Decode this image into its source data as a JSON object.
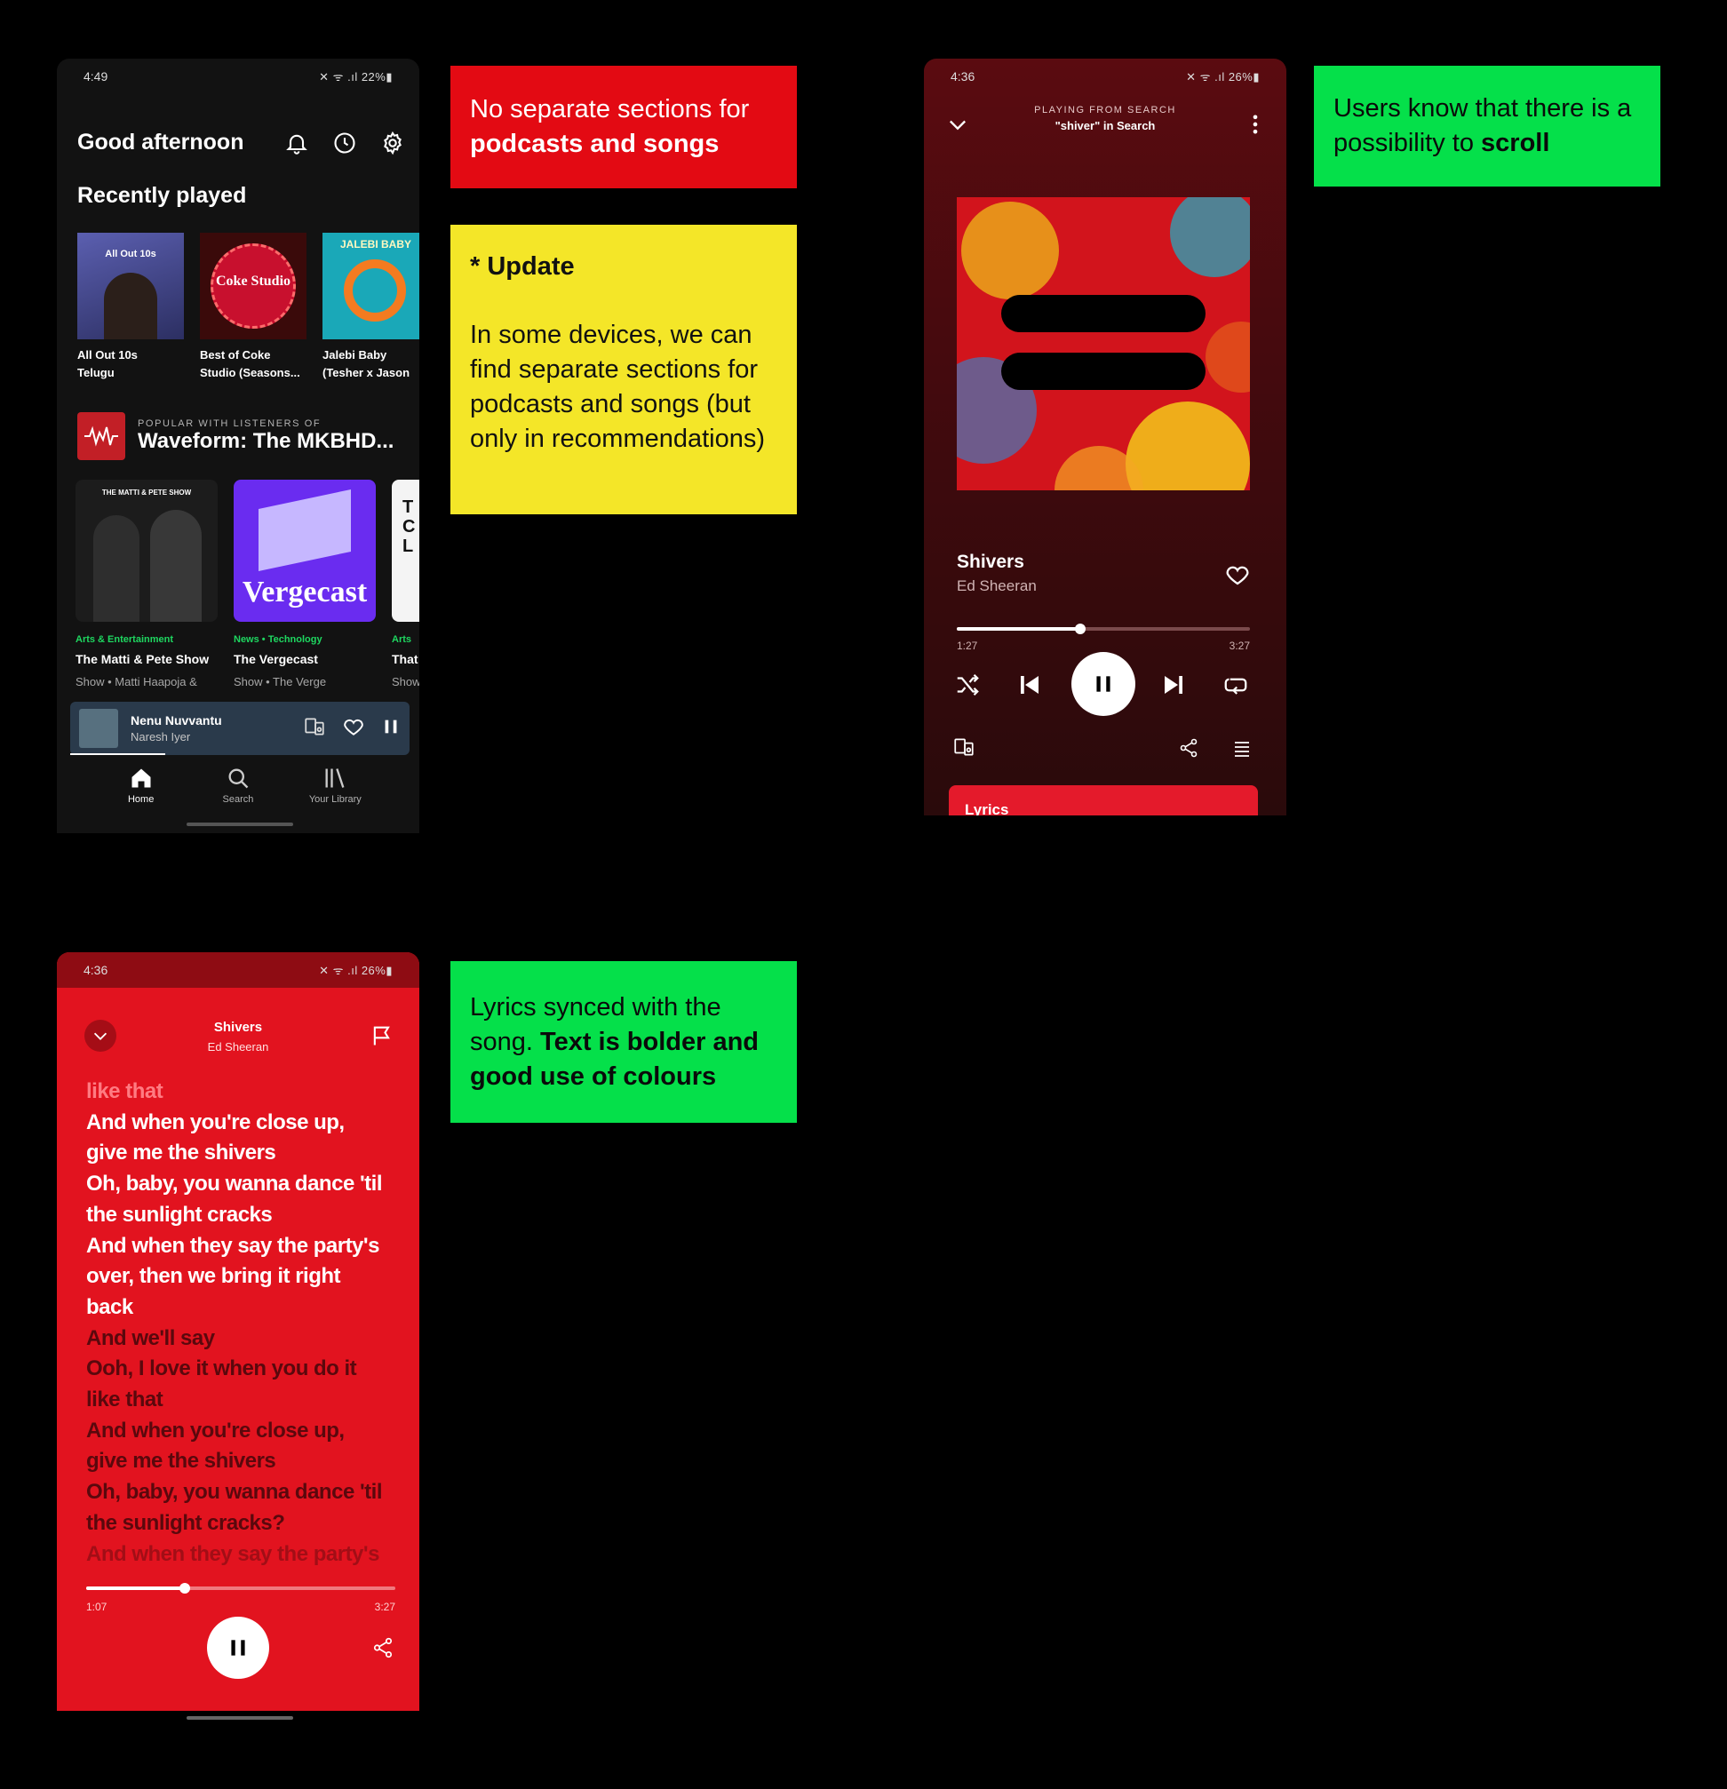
{
  "phone_home": {
    "status": {
      "time": "4:49",
      "right": "✕ ᯤ .ıl 22%▮"
    },
    "greeting": "Good afternoon",
    "recently_played_title": "Recently played",
    "recently_played": [
      {
        "label": "All Out 10s\nTelugu",
        "art_text": "All Out 10s"
      },
      {
        "label": "Best of Coke\nStudio (Seasons...",
        "art_text": "Coke Studio"
      },
      {
        "label": "Jalebi Baby\n(Tesher x Jason",
        "art_text": "JALEBI BABY"
      }
    ],
    "popular_kicker": "POPULAR WITH LISTENERS OF",
    "popular_title": "Waveform: The MKBHD...",
    "podcasts": [
      {
        "category": "Arts & Entertainment",
        "name": "The Matti & Pete Show",
        "sub": "Show • Matti Haapoja &",
        "art_text": "THE MATTI & PETE SHOW"
      },
      {
        "category": "News • Technology",
        "name": "The Vergecast",
        "sub": "Show • The Verge",
        "art_text": "Vergecast"
      },
      {
        "category": "Arts",
        "name": "That",
        "sub": "Show",
        "art_text": "T C L"
      }
    ],
    "mini_player": {
      "title": "Nenu Nuvvantu",
      "artist": "Naresh Iyer",
      "progress": 0.28
    },
    "nav": [
      "Home",
      "Search",
      "Your Library"
    ]
  },
  "phone_now_playing": {
    "status": {
      "time": "4:36",
      "right": "✕ ᯤ .ıl 26%▮"
    },
    "kicker": "PLAYING FROM SEARCH",
    "source": "\"shiver\" in Search",
    "title": "Shivers",
    "artist": "Ed Sheeran",
    "elapsed": "1:27",
    "duration": "3:27",
    "progress": 0.42,
    "lyrics_label": "Lyrics"
  },
  "phone_lyrics": {
    "status": {
      "time": "4:36",
      "right": "✕ ᯤ .ıl 26%▮"
    },
    "title": "Shivers",
    "artist": "Ed Sheeran",
    "line_faded": "like that",
    "lines_active": [
      "And when you're close up,",
      "give me the shivers",
      "Oh, baby, you wanna dance 'til",
      "the sunlight cracks",
      "And when they say the party's",
      "over, then we bring it right",
      "back"
    ],
    "lines_upcoming": [
      "And we'll say",
      "Ooh, I love it when you do it",
      "like that",
      "And when you're close up,",
      "give me the shivers",
      "Oh, baby, you wanna dance 'til",
      "the sunlight cracks?",
      "And when they say the party's"
    ],
    "elapsed": "1:07",
    "duration": "3:27",
    "progress": 0.32
  },
  "notes": {
    "n1_plain": "No separate sections for",
    "n1_bold": "podcasts and songs",
    "n2_heading": "* Update",
    "n2_body": "In some devices, we can find separate sections for podcasts and songs (but only in recommendations)",
    "n3_plain": "Users know that there is a possibility to",
    "n3_bold": "scroll",
    "n4_plain": "Lyrics synced with the song.",
    "n4_bold": "Text is bolder and good use of colours"
  },
  "colors": {
    "spotify_green": "#1ed760",
    "note_red": "#e30a13",
    "note_yellow": "#f4e628",
    "note_green": "#05e04a",
    "lyrics_red": "#e2131f"
  }
}
